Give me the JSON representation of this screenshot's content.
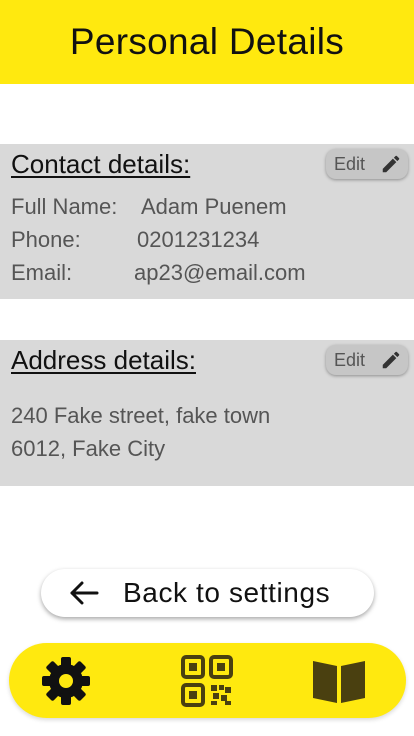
{
  "header": {
    "title": "Personal Details"
  },
  "contact": {
    "title": "Contact details:",
    "edit_label": "Edit",
    "rows": [
      {
        "label": "Full Name:",
        "value": "Adam Puenem"
      },
      {
        "label": "Phone:",
        "value": "0201231234"
      },
      {
        "label": "Email:",
        "value": "ap23@email.com"
      }
    ]
  },
  "address": {
    "title": "Address details:",
    "edit_label": "Edit",
    "line1": "240 Fake street, fake town",
    "line2": "6012, Fake City"
  },
  "back_button": {
    "label": "Back to settings",
    "icon": "arrow-left-icon"
  },
  "nav": {
    "items": [
      {
        "name": "settings",
        "icon": "gear-icon"
      },
      {
        "name": "qr",
        "icon": "qr-code-icon"
      },
      {
        "name": "book",
        "icon": "book-icon"
      }
    ]
  },
  "colors": {
    "accent": "#ffe90f",
    "card_bg": "#d9d9d9",
    "edit_bg": "#c6c6c6",
    "text_dark": "#111111",
    "text_muted": "#555555",
    "icon_dark": "#4a4010"
  }
}
